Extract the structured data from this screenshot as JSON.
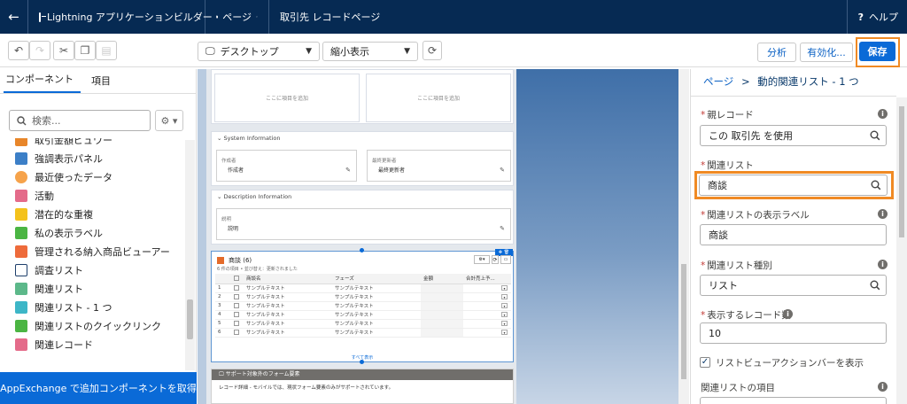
{
  "topbar": {
    "back": "←",
    "app_name": "Lightning アプリケーションビルダー",
    "pages_label": "ページ",
    "record_page": "取引先 レコードページ",
    "help": "ヘルプ"
  },
  "toolbar": {
    "device": "デスクトップ",
    "view": "縮小表示",
    "analyze": "分析",
    "activate": "有効化...",
    "save": "保存"
  },
  "left": {
    "tab_components": "コンポーネント",
    "tab_fields": "項目",
    "search_placeholder": "検索...",
    "items": [
      {
        "label": "取引金額ビュワー",
        "color": "#e8862a"
      },
      {
        "label": "強調表示パネル",
        "color": "#3c7fc7"
      },
      {
        "label": "最近使ったデータ",
        "color": "#f6a34b"
      },
      {
        "label": "活動",
        "color": "#e46b8a"
      },
      {
        "label": "潜在的な重複",
        "color": "#f4c21c"
      },
      {
        "label": "私の表示ラベル",
        "color": "#4bb543"
      },
      {
        "label": "管理される納入商品ビューアー",
        "color": "#ee6b3b"
      },
      {
        "label": "調査リスト",
        "color": "#1e3f6b"
      },
      {
        "label": "関連リスト",
        "color": "#5cb88a"
      },
      {
        "label": "関連リスト - 1 つ",
        "color": "#3db6c7"
      },
      {
        "label": "関連リストのクイックリンク",
        "color": "#4bb543"
      },
      {
        "label": "関連レコード",
        "color": "#e46b8a"
      }
    ],
    "appexchange": "AppExchange で追加コンポーネントを取得"
  },
  "canvas": {
    "add_here": "ここに項目を追加",
    "system_info": "System Information",
    "created_by_label": "作成者",
    "created_by_value": "作成者",
    "modified_by_label": "最終更新者",
    "modified_by_value": "最終更新者",
    "description_info": "Description Information",
    "description_label": "説明",
    "description_value": "説明",
    "related_title": "商談 (6)",
    "related_sub": "6 件の項目 • 並び替え：更新されました",
    "columns": [
      "商談名",
      "フェーズ",
      "金額",
      "合計売上予..."
    ],
    "sample": "サンプルテキスト",
    "row_count": [
      "1",
      "2",
      "3",
      "4",
      "5",
      "6"
    ],
    "show_all": "すべて表示",
    "support_title": "サポート対象外のフォーム要素",
    "support_text": "レコード詳細 - モバイルでは、現状フォーム要素のみがサポートされています。"
  },
  "right": {
    "crumb_page": "ページ",
    "crumb_sep": ">",
    "crumb_current": "動的関連リスト - 1 つ",
    "parent_label": "親レコード",
    "parent_value": "この 取引先 を使用",
    "related_label": "関連リスト",
    "related_value": "商談",
    "display_label": "関連リストの表示ラベル",
    "display_value": "商談",
    "type_label": "関連リスト種別",
    "type_value": "リスト",
    "count_label": "表示するレコード数",
    "count_value": "10",
    "checkbox_label": "リストビューアクションバーを表示",
    "items_label": "関連リストの項目"
  }
}
